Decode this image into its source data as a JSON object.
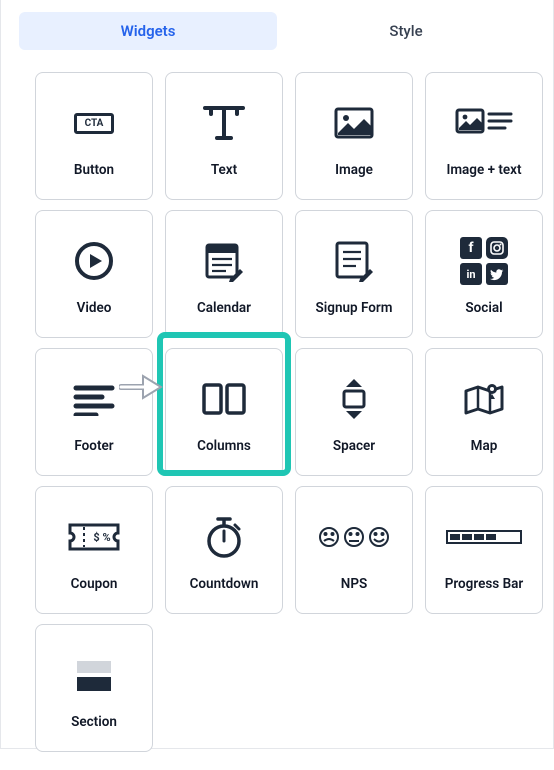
{
  "tabs": {
    "widgets": "Widgets",
    "style": "Style"
  },
  "widgets": [
    {
      "id": "button",
      "label": "Button"
    },
    {
      "id": "text",
      "label": "Text"
    },
    {
      "id": "image",
      "label": "Image"
    },
    {
      "id": "image-text",
      "label": "Image + text"
    },
    {
      "id": "video",
      "label": "Video"
    },
    {
      "id": "calendar",
      "label": "Calendar"
    },
    {
      "id": "signup-form",
      "label": "Signup Form"
    },
    {
      "id": "social",
      "label": "Social"
    },
    {
      "id": "footer",
      "label": "Footer"
    },
    {
      "id": "columns",
      "label": "Columns"
    },
    {
      "id": "spacer",
      "label": "Spacer"
    },
    {
      "id": "map",
      "label": "Map"
    },
    {
      "id": "coupon",
      "label": "Coupon"
    },
    {
      "id": "countdown",
      "label": "Countdown"
    },
    {
      "id": "nps",
      "label": "NPS"
    },
    {
      "id": "progress-bar",
      "label": "Progress Bar"
    },
    {
      "id": "section",
      "label": "Section"
    }
  ],
  "highlighted_widget": "columns",
  "icons": {
    "button_inner_text": "CTA",
    "coupon_inner_text": "$ %"
  },
  "colors": {
    "accent": "#2563eb",
    "highlight": "#1fc6b4",
    "ink": "#1e2a3a"
  }
}
